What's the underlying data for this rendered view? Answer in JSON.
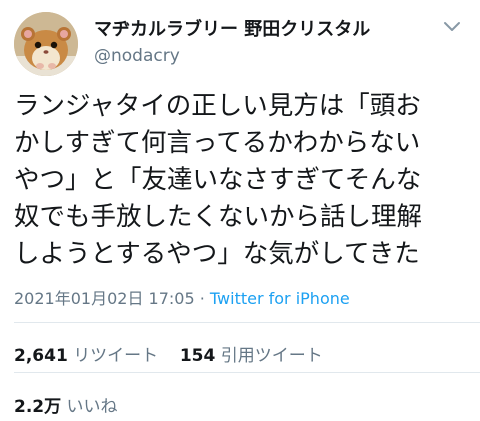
{
  "user": {
    "display_name": "マヂカルラブリー 野田クリスタル",
    "handle": "@nodacry",
    "avatar_icon": "hamster-avatar-icon"
  },
  "tweet": {
    "lines": [
      "ランジャタイの正しい見方は「頭お",
      "かしすぎて何言ってるかわからない",
      "やつ」と「友達いなさすぎてそんな",
      "奴でも手放したくないから話し理解",
      "しようとするやつ」な気がしてきた"
    ],
    "timestamp": "2021年01月02日 17:05",
    "separator": " · ",
    "source": "Twitter for iPhone"
  },
  "stats": {
    "retweets_count": "2,641",
    "retweets_label": "リツイート",
    "quotes_count": "154",
    "quotes_label": "引用ツイート",
    "likes_count": "2.2万",
    "likes_label": "いいね"
  },
  "colors": {
    "text": "#14171a",
    "secondary": "#657786",
    "link": "#1da1f2",
    "divider": "#e1e8ed"
  }
}
